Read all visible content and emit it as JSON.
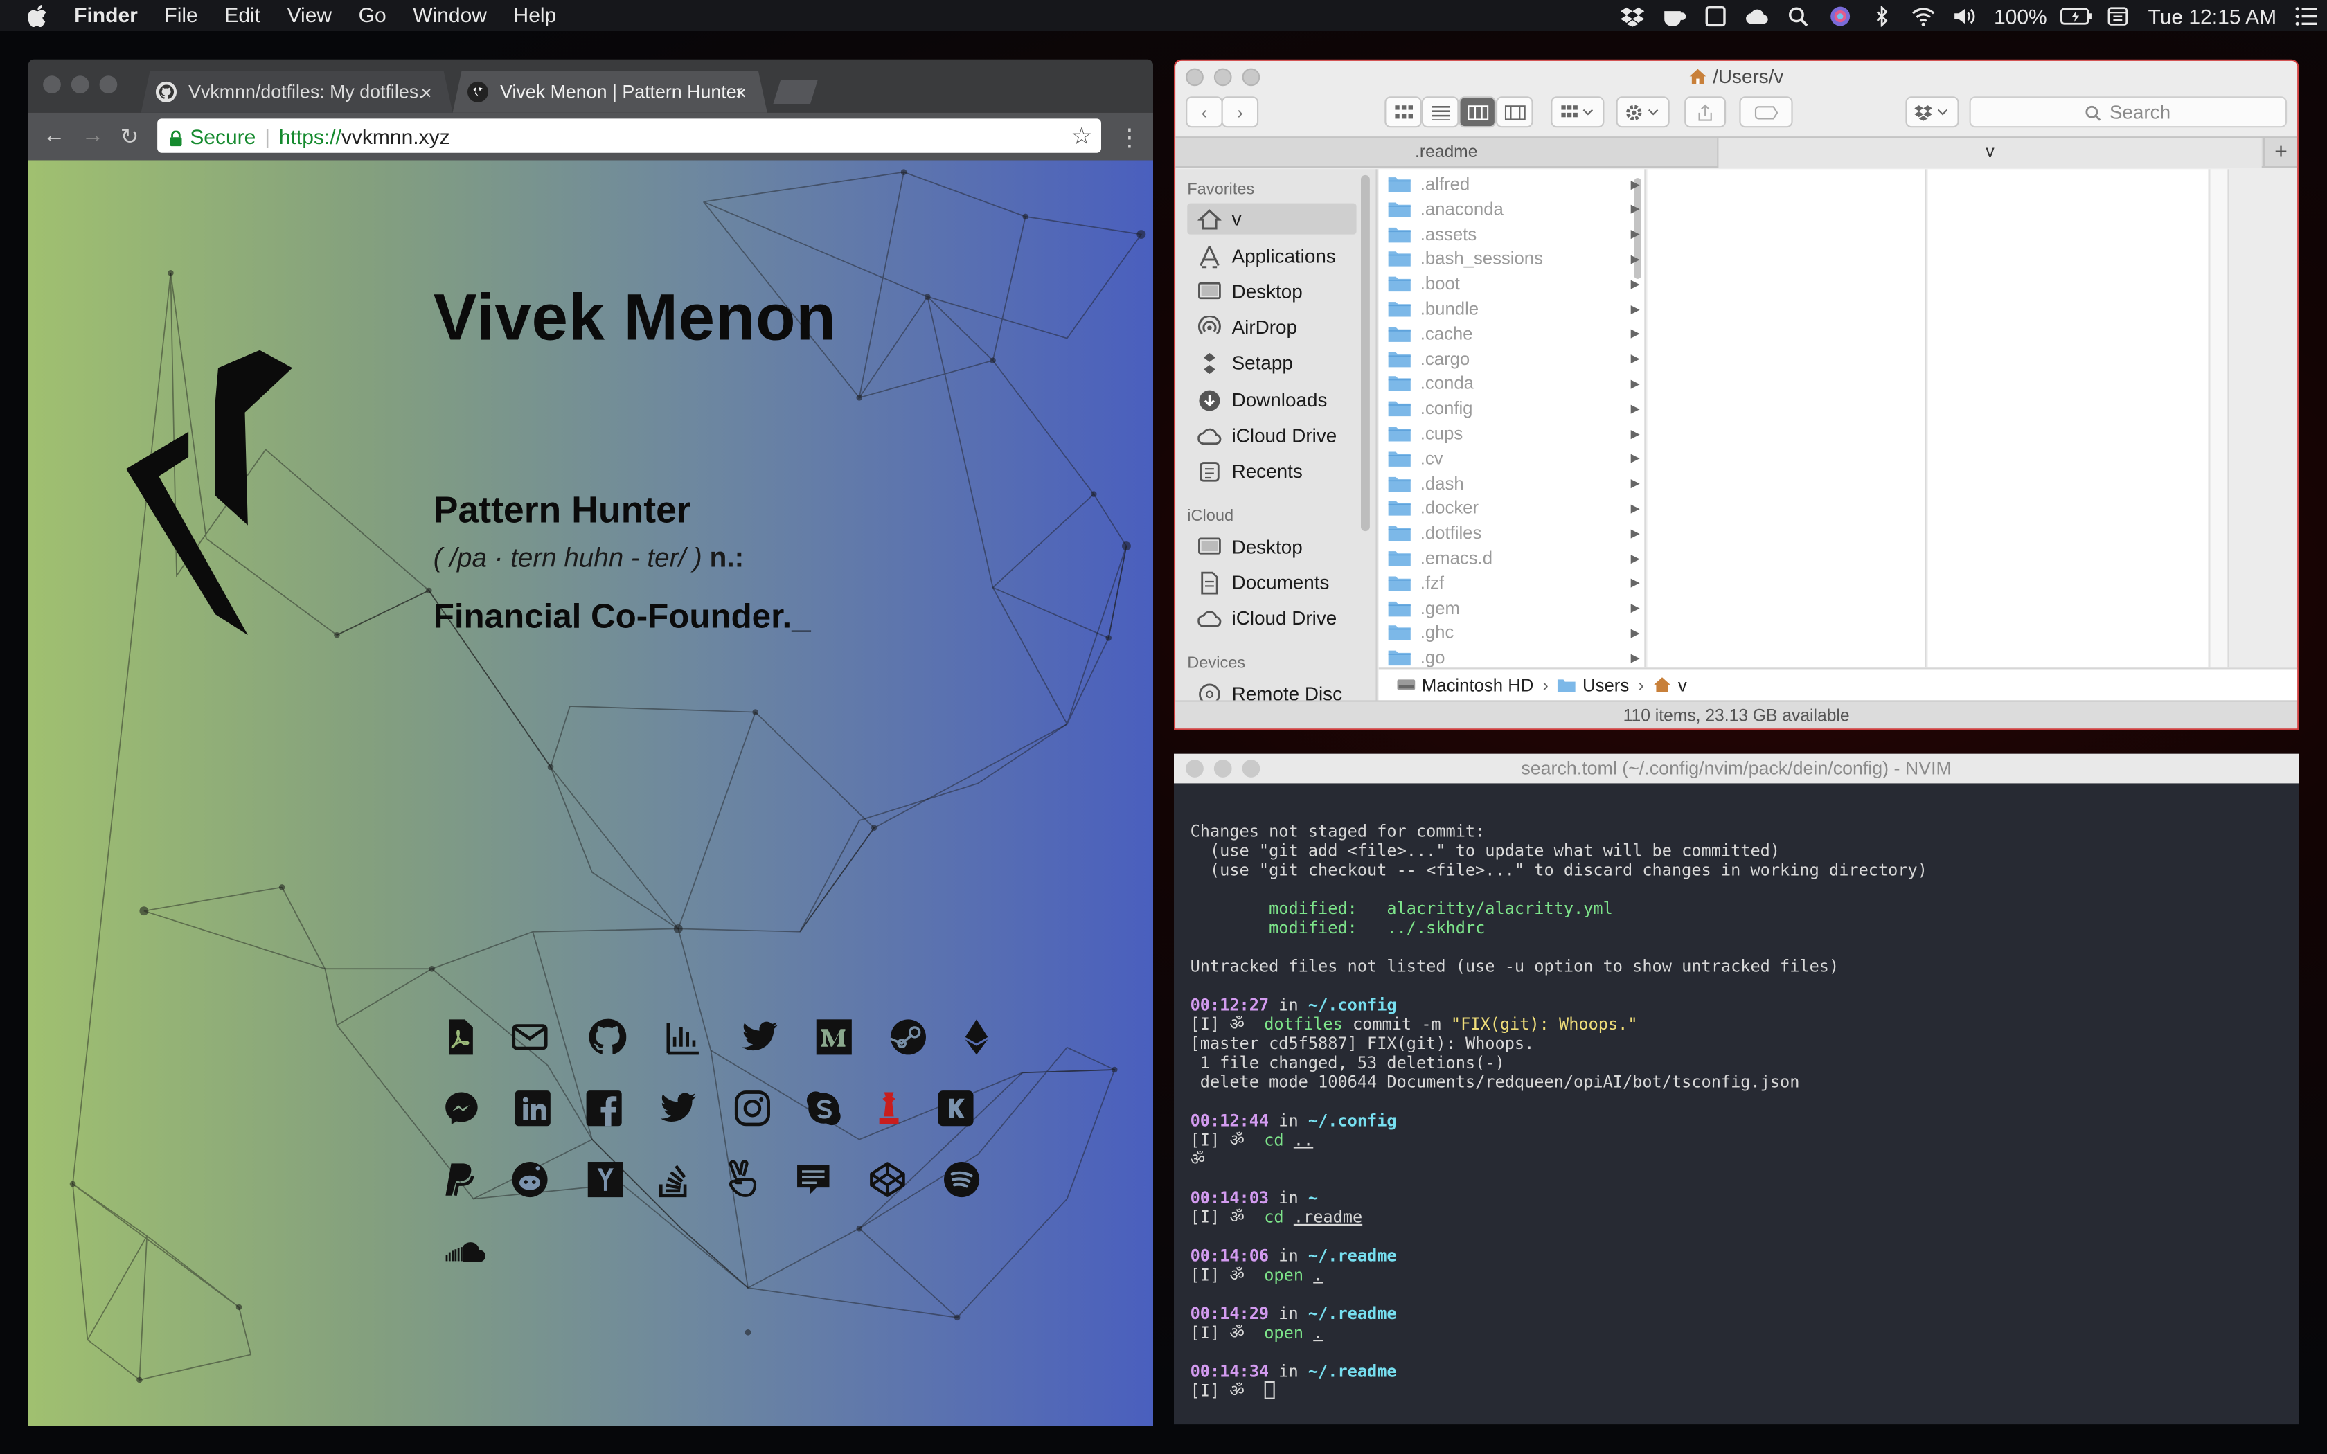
{
  "menubar": {
    "items": [
      "Finder",
      "File",
      "Edit",
      "View",
      "Go",
      "Window",
      "Help"
    ],
    "battery": "100%",
    "clock": "Tue 12:15 AM"
  },
  "browser": {
    "tabs": [
      {
        "title": "Vvkmnn/dotfiles: My dotfiles.",
        "close": "×"
      },
      {
        "title": "Vivek Menon | Pattern Hunter",
        "close": "×"
      }
    ],
    "url_secure": "Secure",
    "url_sep": "|",
    "url_proto": "https://",
    "url_host": "vvkmnn.xyz",
    "page": {
      "name": "Vivek Menon",
      "title": "Pattern Hunter",
      "pronunciation": "( /pa · tern huhn - ter/ )",
      "pos": "n.:",
      "role": "Financial Co-Founder._",
      "social_icons": [
        "pdf-icon",
        "mail-icon",
        "github-icon",
        "stats-icon",
        "twitter-icon",
        "medium-icon",
        "steam-icon",
        "ethereum-icon",
        "messenger-icon",
        "linkedin-icon",
        "facebook-icon",
        "twitter-alt-icon",
        "instagram-icon",
        "skype-icon",
        "chess-icon",
        "kickstarter-icon",
        "paypal-icon",
        "reddit-icon",
        "ycombinator-icon",
        "stackoverflow-icon",
        "angellist-icon",
        "trello-icon",
        "codepen-icon",
        "spotify-icon",
        "soundcloud-icon"
      ]
    }
  },
  "finder": {
    "title": "/Users/v",
    "search_placeholder": "Search",
    "tabs": [
      ".readme",
      "v",
      "+"
    ],
    "sidebar": {
      "favorites_label": "Favorites",
      "favorites": [
        "v",
        "Applications",
        "Desktop",
        "AirDrop",
        "Setapp",
        "Downloads",
        "iCloud Drive",
        "Recents"
      ],
      "icloud_label": "iCloud",
      "icloud": [
        "Desktop",
        "Documents",
        "iCloud Drive"
      ],
      "devices_label": "Devices",
      "devices": [
        "Remote Disc"
      ]
    },
    "files": [
      ".alfred",
      ".anaconda",
      ".assets",
      ".bash_sessions",
      ".boot",
      ".bundle",
      ".cache",
      ".cargo",
      ".conda",
      ".config",
      ".cups",
      ".cv",
      ".dash",
      ".docker",
      ".dotfiles",
      ".emacs.d",
      ".fzf",
      ".gem",
      ".ghc",
      ".go"
    ],
    "path": [
      "Macintosh HD",
      "Users",
      "v"
    ],
    "status": "110 items, 23.13 GB available"
  },
  "terminal": {
    "title": "search.toml (~/.config/nvim/pack/dein/config) - NVIM",
    "lines": [
      {
        "t": "Changes not staged for commit:"
      },
      {
        "t": "  (use \"git add <file>...\" to update what will be committed)"
      },
      {
        "t": "  (use \"git checkout -- <file>...\" to discard changes in working directory)"
      },
      {
        "t": ""
      },
      {
        "mod_label": "        modified:   ",
        "mod_file": "alacritty/alacritty.yml"
      },
      {
        "mod_label": "        modified:   ",
        "mod_file": "../.skhdrc"
      },
      {
        "t": ""
      },
      {
        "t": "Untracked files not listed (use -u option to show untracked files)"
      },
      {
        "t": ""
      },
      {
        "time": "00:12:27",
        "in": " in ",
        "dir": "~/.config"
      },
      {
        "prompt": "[I] ॐ  ",
        "cmd": "dotfiles",
        "arg1": " commit -m ",
        "str": "\"FIX(git): Whoops.\""
      },
      {
        "t": "[master cd5f5887] FIX(git): Whoops."
      },
      {
        "t": " 1 file changed, 53 deletions(-)"
      },
      {
        "t": " delete mode 100644 Documents/redqueen/opiAI/bot/tsconfig.json"
      },
      {
        "t": ""
      },
      {
        "time": "00:12:44",
        "in": " in ",
        "dir": "~/.config"
      },
      {
        "prompt": "[I] ॐ  ",
        "cmd": "cd",
        "arg": " ",
        "path": ".."
      },
      {
        "t": "ॐ"
      },
      {
        "t": ""
      },
      {
        "time": "00:14:03",
        "in": " in ",
        "dir": "~"
      },
      {
        "prompt": "[I] ॐ  ",
        "cmd": "cd",
        "arg": " ",
        "path": ".readme"
      },
      {
        "t": ""
      },
      {
        "time": "00:14:06",
        "in": " in ",
        "dir": "~/.readme"
      },
      {
        "prompt": "[I] ॐ  ",
        "cmd": "open",
        "arg": " ",
        "path": "."
      },
      {
        "t": ""
      },
      {
        "time": "00:14:29",
        "in": " in ",
        "dir": "~/.readme"
      },
      {
        "prompt": "[I] ॐ  ",
        "cmd": "open",
        "arg": " ",
        "path": "."
      },
      {
        "t": ""
      },
      {
        "time": "00:14:34",
        "in": " in ",
        "dir": "~/.readme"
      },
      {
        "prompt": "[I] ॐ  ",
        "cursor": true
      }
    ]
  }
}
